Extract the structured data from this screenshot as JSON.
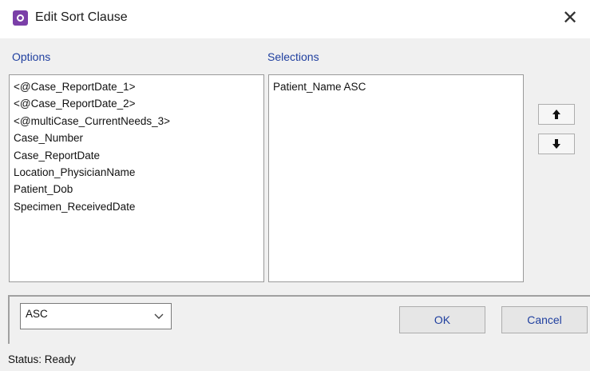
{
  "window": {
    "title": "Edit Sort Clause",
    "close_glyph": "✕"
  },
  "options": {
    "label": "Options",
    "items": [
      "<@Case_ReportDate_1>",
      "<@Case_ReportDate_2>",
      "<@multiCase_CurrentNeeds_3>",
      "Case_Number",
      "Case_ReportDate",
      "Location_PhysicianName",
      "Patient_Dob",
      "Specimen_ReceivedDate"
    ]
  },
  "selections": {
    "label": "Selections",
    "items": [
      "Patient_Name ASC"
    ]
  },
  "order_dropdown": {
    "selected": "ASC"
  },
  "buttons": {
    "ok": "OK",
    "cancel": "Cancel"
  },
  "status": {
    "text": "Status: Ready"
  },
  "colors": {
    "label_blue": "#1f3f9f",
    "app_icon": "#7b3fa8"
  },
  "icons": {
    "app": "app-logo-icon",
    "close": "close-icon",
    "move_up": "arrow-up-icon",
    "move_down": "arrow-down-icon",
    "dropdown": "chevron-down-icon"
  }
}
